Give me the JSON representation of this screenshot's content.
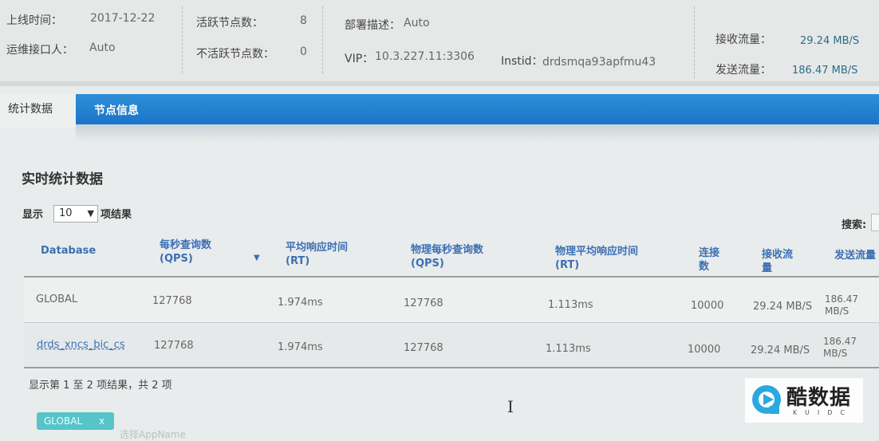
{
  "info": {
    "online_time_label": "上线时间：",
    "online_time_value": "2017-12-22",
    "ops_contact_label": "运维接口人：",
    "ops_contact_value": "Auto",
    "active_nodes_label": "活跃节点数：",
    "active_nodes_value": "8",
    "inactive_nodes_label": "不活跃节点数：",
    "inactive_nodes_value": "0",
    "deploy_desc_label": "部署描述：",
    "deploy_desc_value": "Auto",
    "vip_label": "VIP：",
    "vip_value": "10.3.227.11:3306",
    "instid_label": "Instid：",
    "instid_value": "drdsmqa93apfmu43",
    "recv_label": "接收流量：",
    "recv_value": "29.24 MB/S",
    "send_label": "发送流量：",
    "send_value": "186.47 MB/S"
  },
  "tabs": [
    {
      "label": "统计数据",
      "active": true
    },
    {
      "label": "节点信息",
      "active": false
    }
  ],
  "section_title": "实时统计数据",
  "length": {
    "prefix": "显示",
    "selected": "10",
    "suffix": "项结果"
  },
  "search_label": "搜索:",
  "table": {
    "headers": [
      "Database",
      "每秒查询数 (QPS)",
      "平均响应时间 (RT)",
      "物理每秒查询数 (QPS)",
      "物理平均响应时间 (RT)",
      "连接数",
      "接收流量",
      "发送流量"
    ],
    "rows": [
      [
        "GLOBAL",
        "127768",
        "1.974ms",
        "127768",
        "1.113ms",
        "10000",
        "29.24 MB/S",
        "186.47 MB/S"
      ],
      [
        "drds_xncs_bic_cs",
        "127768",
        "1.974ms",
        "127768",
        "1.113ms",
        "10000",
        "29.24 MB/S",
        "186.47 MB/S"
      ]
    ]
  },
  "result_info": "显示第 1 至 2 项结果，共 2 项",
  "filter_tag": {
    "label": "GLOBAL",
    "close": "x"
  },
  "faded_text": "选择AppName",
  "watermark": {
    "text": "酷数据",
    "sub": "KUIDC"
  },
  "colors": {
    "tab_blue": "#1a73c9",
    "link_blue": "#3b6fb4",
    "tag_teal": "#56c4c8"
  }
}
